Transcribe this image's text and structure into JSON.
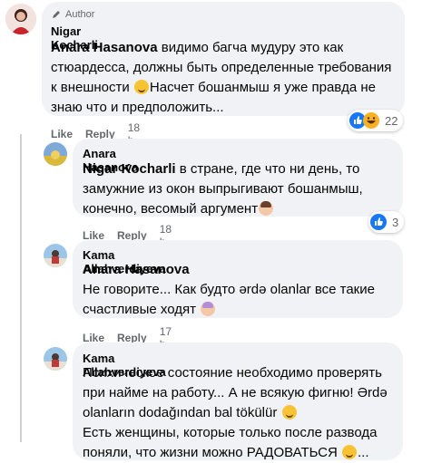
{
  "comments": [
    {
      "badge": "Author",
      "author": "Nigar Kocharli",
      "mention": "Anara Hasanova",
      "lines": [
        "видимо багча мудуру это как",
        "стюардесса, должны быть определенные требования",
        "к внешности",
        "Насчет бошанмыш я уже правда не",
        "знаю что и предположить..."
      ],
      "like": "Like",
      "reply": "Reply",
      "time": "18 h",
      "reaction_count": "22"
    },
    {
      "author": "Anara Hasanova",
      "mention": "Nigar Kocharli",
      "lines": [
        "в стране, где что ни день, то",
        "замужние из окон выпрыгивают бошанмыш,",
        "конечно, весомый аргумент"
      ],
      "like": "Like",
      "reply": "Reply",
      "time": "18 h",
      "reaction_count": "3"
    },
    {
      "author": "Kama Allahverdiyeva",
      "mention": "Anara Hasanova",
      "lines": [
        "Не говорите... Как будто ərdə olanlar все такие",
        "счастливые ходят"
      ],
      "like": "Like",
      "reply": "Reply",
      "time": "17 h"
    },
    {
      "author": "Kama Allahverdiyeva",
      "lines": [
        "Психическое состояние необходимо проверять",
        "при найме на работу... А не всякую фигню! Ərdə",
        "olanların dodağından bal tökülür",
        "Есть женщины, которые только после развода",
        "поняли, что жизни можно РАДОВАТЬСЯ",
        "..."
      ]
    }
  ],
  "colors": {
    "bubble": "#f0f2f5",
    "meta": "#65676b",
    "like_blue": "#1877f2",
    "haha_yellow": "#f7b125"
  },
  "icons": [
    "pen-icon",
    "like-reaction-icon",
    "haha-reaction-icon",
    "grinning-emoji",
    "woman-emoji"
  ]
}
